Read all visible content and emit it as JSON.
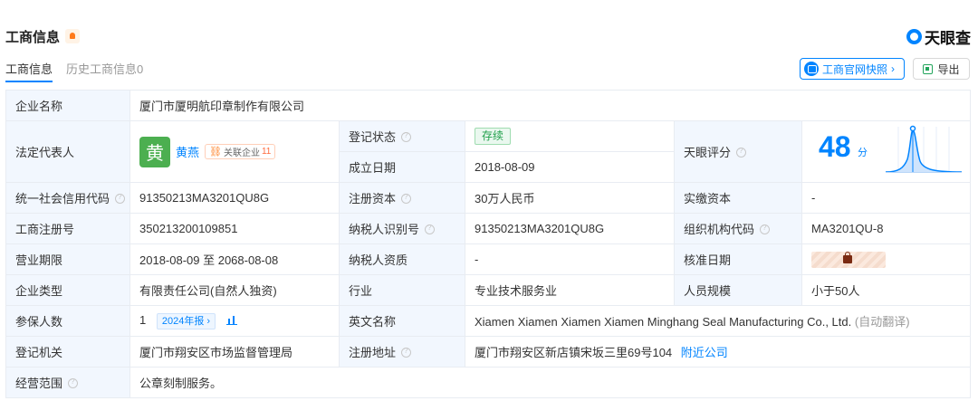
{
  "header": {
    "title": "工商信息",
    "logo_text": "天眼查"
  },
  "tabs": [
    {
      "label": "工商信息"
    },
    {
      "label": "历史工商信息0"
    }
  ],
  "actions": {
    "snapshot_label": "工商官网快照",
    "snapshot_arrow": "›",
    "export_label": "导出"
  },
  "info": {
    "company_name_label": "企业名称",
    "company_name": "厦门市厦明航印章制作有限公司",
    "legal_rep_label": "法定代表人",
    "legal_rep_avatar": "黄",
    "legal_rep_name": "黄燕",
    "related_label": "关联企业",
    "related_count": "11",
    "reg_status_label": "登记状态",
    "reg_status": "存续",
    "established_label": "成立日期",
    "established": "2018-08-09",
    "score_label": "天眼评分",
    "score": "48",
    "score_unit": "分",
    "credit_code_label": "统一社会信用代码",
    "credit_code": "91350213MA3201QU8G",
    "reg_capital_label": "注册资本",
    "reg_capital": "30万人民币",
    "paid_capital_label": "实缴资本",
    "paid_capital": "-",
    "reg_no_label": "工商注册号",
    "reg_no": "350213200109851",
    "taxpayer_id_label": "纳税人识别号",
    "taxpayer_id": "91350213MA3201QU8G",
    "org_code_label": "组织机构代码",
    "org_code": "MA3201QU-8",
    "biz_term_label": "营业期限",
    "biz_term": "2018-08-09 至 2068-08-08",
    "taxpayer_qual_label": "纳税人资质",
    "taxpayer_qual": "-",
    "approval_date_label": "核准日期",
    "company_type_label": "企业类型",
    "company_type": "有限责任公司(自然人独资)",
    "industry_label": "行业",
    "industry": "专业技术服务业",
    "staff_size_label": "人员规模",
    "staff_size": "小于50人",
    "insured_label": "参保人数",
    "insured": "1",
    "annual_report": "2024年报 ›",
    "english_name_label": "英文名称",
    "english_name": "Xiamen Xiamen Xiamen Xiamen Minghang Seal Manufacturing Co., Ltd.",
    "auto_translate": "(自动翻译)",
    "reg_authority_label": "登记机关",
    "reg_authority": "厦门市翔安区市场监督管理局",
    "reg_address_label": "注册地址",
    "reg_address": "厦门市翔安区新店镇宋坂三里69号104",
    "nearby_link": "附近公司",
    "scope_label": "经营范围",
    "scope": "公章刻制服务。"
  },
  "colors": {
    "accent": "#0084ff",
    "label_bg": "#f2f7fe",
    "status_green": "#21a04b"
  }
}
